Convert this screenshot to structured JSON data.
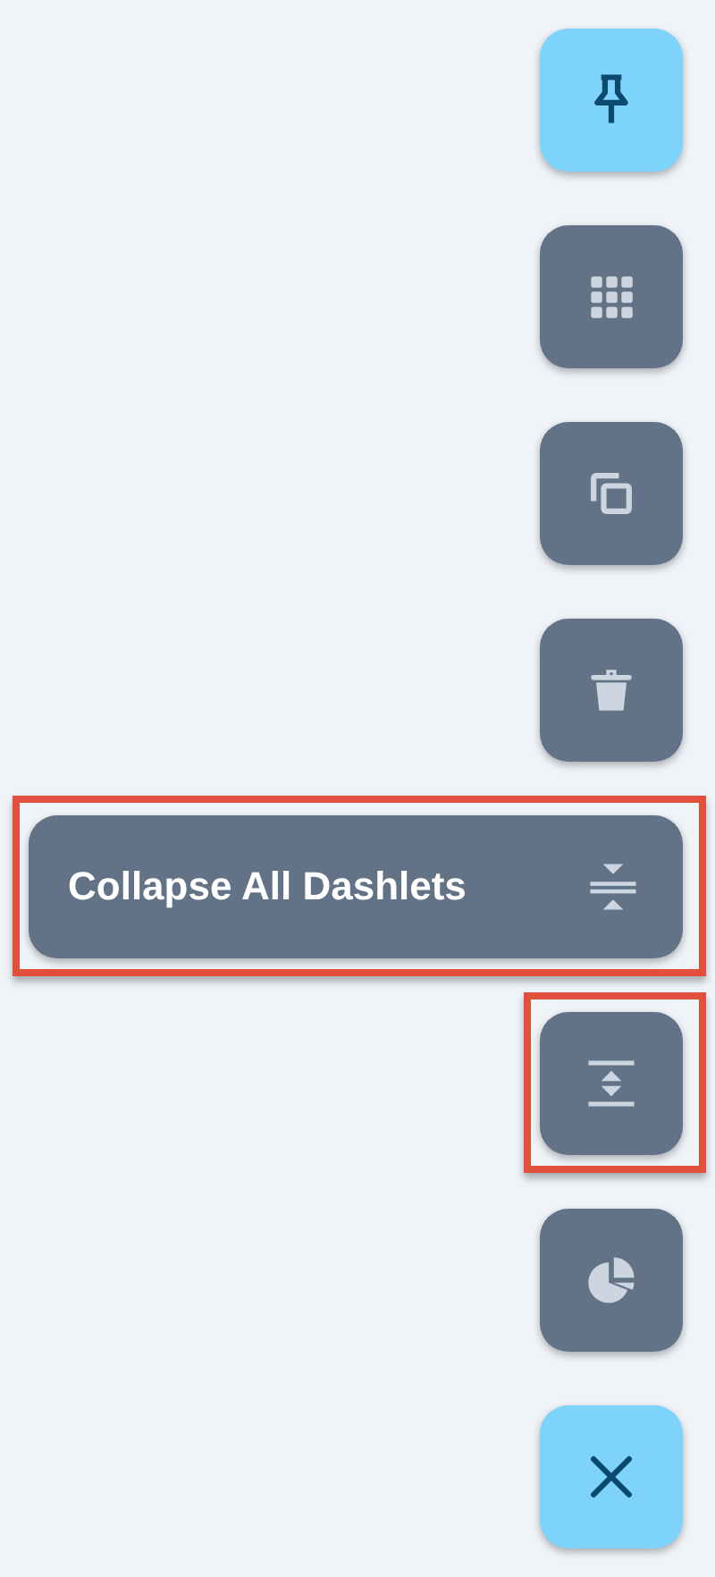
{
  "actions": [
    {
      "kind": "pin",
      "primary": true,
      "highlighted": false
    },
    {
      "kind": "grid",
      "primary": false,
      "highlighted": false
    },
    {
      "kind": "copy",
      "primary": false,
      "highlighted": false
    },
    {
      "kind": "trash",
      "primary": false,
      "highlighted": false
    },
    {
      "kind": "collapse",
      "label": "Collapse All Dashlets",
      "primary": false,
      "highlighted": true
    },
    {
      "kind": "expand",
      "primary": false,
      "highlighted": true
    },
    {
      "kind": "chart",
      "primary": false,
      "highlighted": false
    },
    {
      "kind": "close",
      "primary": true,
      "highlighted": false
    }
  ]
}
